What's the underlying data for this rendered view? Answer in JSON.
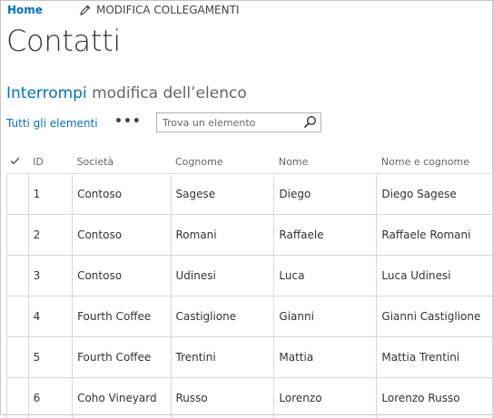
{
  "nav": {
    "home": "Home",
    "edit_links": "MODIFICA COLLEGAMENTI"
  },
  "page": {
    "title": "Contatti",
    "stop_link": "Interrompi",
    "stop_rest": " modifica dell’elenco"
  },
  "toolbar": {
    "view": "Tutti gli elementi",
    "more": "•••",
    "search_placeholder": "Trova un elemento"
  },
  "table": {
    "columns": [
      "ID",
      "Società",
      "Cognome",
      "Nome",
      "Nome e cognome"
    ],
    "rows": [
      [
        "1",
        "Contoso",
        "Sagese",
        "Diego",
        "Diego Sagese"
      ],
      [
        "2",
        "Contoso",
        "Romani",
        "Raffaele",
        "Raffaele Romani"
      ],
      [
        "3",
        "Contoso",
        "Udinesi",
        "Luca",
        "Luca Udinesi"
      ],
      [
        "4",
        "Fourth Coffee",
        "Castiglione",
        "Gianni",
        "Gianni Castiglione"
      ],
      [
        "5",
        "Fourth Coffee",
        "Trentini",
        "Mattia",
        "Mattia Trentini"
      ],
      [
        "6",
        "Coho Vineyard",
        "Russo",
        "Lorenzo",
        "Lorenzo Russo"
      ]
    ]
  }
}
